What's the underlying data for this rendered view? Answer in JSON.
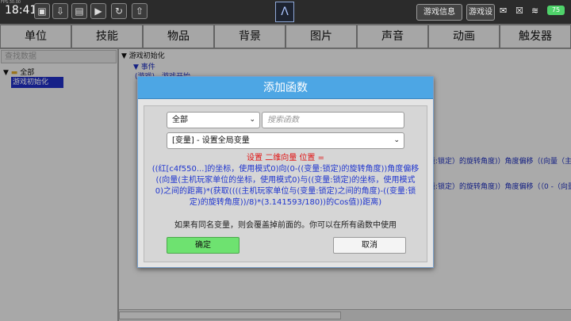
{
  "status": {
    "fps": "FPS:30.00",
    "time": "18:41",
    "battery": "75"
  },
  "top_buttons": {
    "game_info": "游戏信息",
    "game_settings": "游戏设"
  },
  "tabs": [
    "单位",
    "技能",
    "物品",
    "背景",
    "图片",
    "声音",
    "动画",
    "触发器"
  ],
  "left": {
    "search_placeholder": "查找数据",
    "tree_all": "全部",
    "tree_selected": "游戏初始化"
  },
  "right": {
    "root": "▼ 游戏初始化",
    "events": "▼ 事件",
    "partial_line": "(游戏)…游戏开始",
    "bg_line1": "量:锁定）的旋转角度)）角度偏移（(向量（主",
    "bg_line2": "量:锁定）的旋转角度)）角度偏移（（0 -（向量"
  },
  "dialog": {
    "title": "添加函数",
    "category": "全部",
    "search_placeholder": "搜索函数",
    "function": "[变量] - 设置全局变量",
    "formula_head": "设置 二维向量  位置 =",
    "formula_lines": [
      "((红[c4f550...]的坐标，使用模式0)向(0-((变量:锁定)的旋转角度))角度偏移",
      "((向量(主机玩家单位的坐标，使用模式0)与((变量:锁定)的坐标，使用模式",
      "0)之间的距离)*(获取((((主机玩家单位与(变量:锁定)之间的角度)-((变量:锁",
      "定)的旋转角度))/8)*(3.141593/180))的Cos值))距离)"
    ],
    "note": "如果有同名变量，则会覆盖掉前面的。你可以在所有函数中使用",
    "ok": "确定",
    "cancel": "取消"
  }
}
